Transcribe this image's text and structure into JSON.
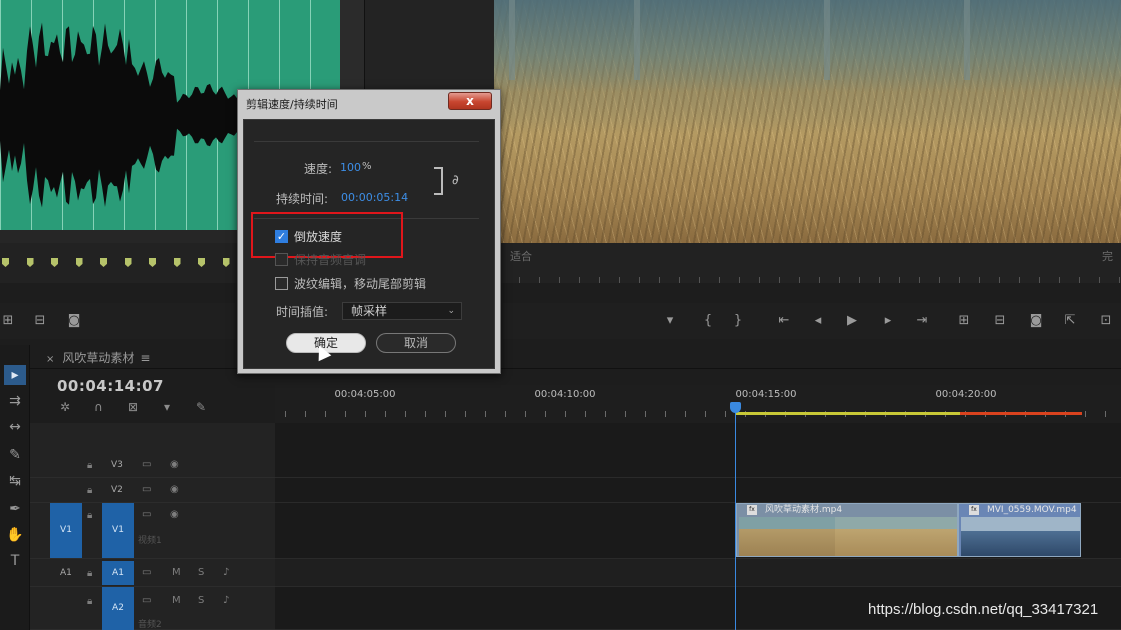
{
  "dialog": {
    "title": "剪辑速度/持续时间",
    "close_label": "x",
    "speed_label": "速度:",
    "speed_value": "100",
    "speed_unit": "%",
    "duration_label": "持续时间:",
    "duration_value": "00:00:05:14",
    "reverse_label": "倒放速度",
    "reverse_checked": true,
    "maintain_pitch_label": "保持音频音调",
    "ripple_label": "波纹编辑，移动尾部剪辑",
    "interp_label": "时间插值:",
    "interp_value": "帧采样",
    "ok_label": "确定",
    "cancel_label": "取消"
  },
  "timeline": {
    "sequence_name": "风吹草动素材",
    "timecode": "00:04:14:07",
    "ruler_labels": [
      "00:04:05:00",
      "00:04:10:00",
      "00:04:15:00",
      "00:04:20:00"
    ],
    "tracks": {
      "v3": "V3",
      "v2": "V2",
      "v1": "V1",
      "v1_src": "V1",
      "v1_name": "视频1",
      "a1": "A1",
      "a1_src": "A1",
      "a2": "A2",
      "a2_name": "音频2"
    },
    "clips": [
      "风吹草动素材.mp4",
      "MVI_0559.MOV.mp4"
    ]
  },
  "monitor": {
    "fit_label": "适合",
    "fx_badge": "fx"
  },
  "colors": {
    "accent": "#2f7ee0",
    "highlight_box": "#e0161b",
    "waveform_bg": "#2a9c78",
    "playhead": "#3a89e0"
  },
  "watermark": "https://blog.csdn.net/qq_33417321"
}
